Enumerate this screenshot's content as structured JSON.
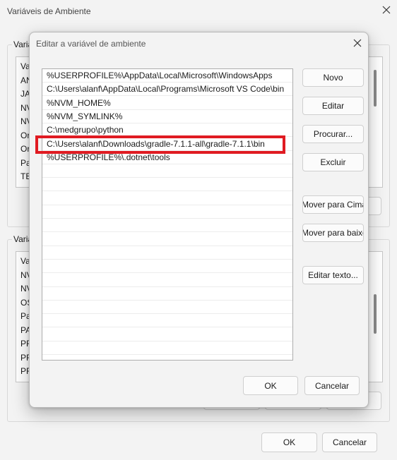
{
  "background_window": {
    "title": "Variáveis de Ambiente",
    "user_group_label": "Variá",
    "system_group_label": "Variá",
    "user_vars_visible": [
      "Va",
      "AN",
      "JA",
      "NV",
      "NV",
      "Or",
      "Or",
      "Pa",
      "TE"
    ],
    "system_vars_visible": [
      "Va",
      "NV",
      "NV",
      "OS",
      "Pa",
      "PA",
      "PR",
      "PR",
      "PR"
    ],
    "ok_label": "OK",
    "cancel_label": "Cancelar"
  },
  "dialog": {
    "title": "Editar a variável de ambiente",
    "paths": [
      "%USERPROFILE%\\AppData\\Local\\Microsoft\\WindowsApps",
      "C:\\Users\\alanf\\AppData\\Local\\Programs\\Microsoft VS Code\\bin",
      "%NVM_HOME%",
      "%NVM_SYMLINK%",
      "C:\\medgrupo\\python",
      "C:\\Users\\alanf\\Downloads\\gradle-7.1.1-all\\gradle-7.1.1\\bin",
      "%USERPROFILE%\\.dotnet\\tools"
    ],
    "selected_index": 5,
    "buttons": {
      "new": "Novo",
      "edit": "Editar",
      "browse": "Procurar...",
      "delete": "Excluir",
      "move_up": "Mover para Cima",
      "move_down": "Mover para baixo",
      "edit_text": "Editar texto..."
    },
    "ok_label": "OK",
    "cancel_label": "Cancelar"
  },
  "colors": {
    "highlight_border": "#e01b22",
    "window_bg": "#f3f3f3"
  }
}
